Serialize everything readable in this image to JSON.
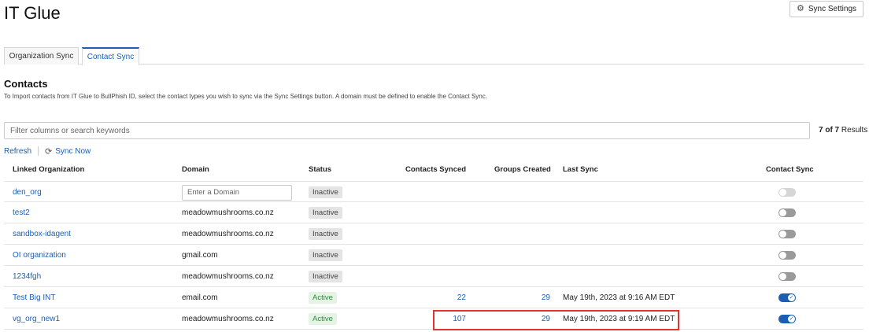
{
  "page": {
    "title": "IT Glue"
  },
  "toolbar": {
    "sync_settings_label": "Sync Settings",
    "sync_settings_icon": "gear-icon"
  },
  "tabs": [
    {
      "label": "Organization Sync",
      "active": false
    },
    {
      "label": "Contact Sync",
      "active": true
    }
  ],
  "section": {
    "title": "Contacts",
    "description": "To Import contacts from IT Glue to BullPhish ID, select the contact types you wish to sync via the Sync Settings button. A domain must be defined to enable the Contact Sync."
  },
  "search": {
    "placeholder": "Filter columns or search keywords",
    "value": ""
  },
  "results": {
    "count": "7 of 7",
    "suffix": "Results"
  },
  "actions": {
    "refresh_label": "Refresh",
    "sync_now_label": "Sync Now",
    "sync_now_icon": "sync-icon"
  },
  "table": {
    "columns": [
      "Linked Organization",
      "Domain",
      "Status",
      "Contacts Synced",
      "Groups Created",
      "Last Sync",
      "Contact Sync"
    ],
    "domain_placeholder": "Enter a Domain",
    "rows": [
      {
        "org": "den_org",
        "domain": "",
        "status": "Inactive",
        "contacts": "",
        "groups": "",
        "last_sync": "",
        "sync": "disabled"
      },
      {
        "org": "test2",
        "domain": "meadowmushrooms.co.nz",
        "status": "Inactive",
        "contacts": "",
        "groups": "",
        "last_sync": "",
        "sync": "off"
      },
      {
        "org": "sandbox-idagent",
        "domain": "meadowmushrooms.co.nz",
        "status": "Inactive",
        "contacts": "",
        "groups": "",
        "last_sync": "",
        "sync": "off"
      },
      {
        "org": "OI organization",
        "domain": "gmail.com",
        "status": "Inactive",
        "contacts": "",
        "groups": "",
        "last_sync": "",
        "sync": "off"
      },
      {
        "org": "1234fgh",
        "domain": "meadowmushrooms.co.nz",
        "status": "Inactive",
        "contacts": "",
        "groups": "",
        "last_sync": "",
        "sync": "off"
      },
      {
        "org": "Test Big INT",
        "domain": "email.com",
        "status": "Active",
        "contacts": "22",
        "groups": "29",
        "last_sync": "May 19th, 2023 at 9:16 AM EDT",
        "sync": "on"
      },
      {
        "org": "vg_org_new1",
        "domain": "meadowmushrooms.co.nz",
        "status": "Active",
        "contacts": "107",
        "groups": "29",
        "last_sync": "May 19th, 2023 at 9:19 AM EDT",
        "sync": "on"
      }
    ]
  },
  "colors": {
    "accent": "#1a5fb4",
    "highlight": "#e0352e",
    "active_status": "#2e8b3d"
  }
}
